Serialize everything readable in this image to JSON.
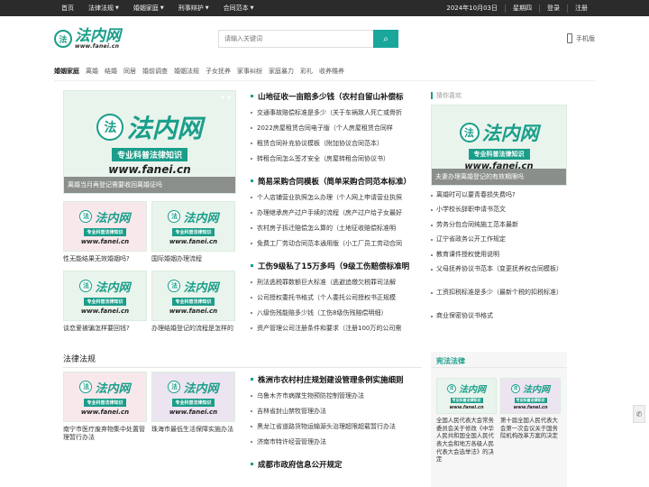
{
  "topnav": {
    "left": [
      "首页",
      "法律法规",
      "婚姻家庭",
      "刑事辩护",
      "合同范本"
    ],
    "right": [
      "2024年10月03日",
      "星期四",
      "登录",
      "注册"
    ]
  },
  "logo": {
    "cn": "法内网",
    "url": "www.fanei.cn",
    "badge": "法"
  },
  "search": {
    "placeholder": "请输入关键词",
    "button_icon": "search-icon"
  },
  "mobile": {
    "label": "手机版"
  },
  "catnav": [
    "婚姻家庭",
    "离婚",
    "结婚",
    "同居",
    "婚前调查",
    "婚姻法规",
    "子女抚养",
    "家事纠纷",
    "家庭暴力",
    "彩礼",
    "收养赡养"
  ],
  "thumb_text": {
    "cn": "法内网",
    "band": "专业科普法律知识",
    "url": "www.fanei.cn",
    "badge": "法"
  },
  "featured": {
    "caption": "离婚当月再登记需要收回离婚证吗"
  },
  "small_cards": [
    {
      "caption": "性无能结果无效婚姻吗?"
    },
    {
      "caption": "国际婚姻办理流程"
    },
    {
      "caption": "谈恋爱被骗怎样要回钱?"
    },
    {
      "caption": "办理结婚登记的流程是怎样的"
    }
  ],
  "news_blocks": [
    {
      "headline": "山地征收一亩赔多少钱（农村自留山补偿标",
      "items": [
        "交通事故赔偿标准是多少（关于车祸致人死亡或骨折",
        "2022房屋租赁合同电子版（个人房屋租赁合同样",
        "租赁合同补充协议模板（附加协议合同范本）",
        "转租合同怎么签才安全（房屋转租合同协议书）"
      ]
    },
    {
      "headline": "简易采购合同模板（简单采购合同范本标准）",
      "items": [
        "个人店铺营业执照怎么办理（个人网上申请营业执照",
        "办理继承房产过户手续的流程（房产过户给子女最好",
        "农村房子拆迁赔偿怎么算的（土地征收赔偿标准明",
        "免费工厂劳动合同范本通用版（小工厂员工劳动合同"
      ]
    },
    {
      "headline": "工伤9级私了15万多吗（9级工伤赔偿标准明",
      "items": [
        "刑法逃税罪数额巨大标准（逃避追缴欠税罪司法解",
        "公司授权委托书格式（个人委托公司授权书正规模",
        "八级伤残能赔多少钱（工伤8级伤残赔偿明细）",
        "资产管理公司注册条件和要求（注册100万的公司需"
      ]
    }
  ],
  "sidebar": {
    "title": "猜你喜欢",
    "thumb_caption": "夫妻办理离婚登记的有效期限吗",
    "items": [
      "离婚时可以要青春损失费吗?",
      "小学校长辞职申请书范文",
      "劳务分包合同纯施工范本最新",
      "辽宁省政务公开工作规定",
      "教育课件授权使用说明",
      "父母抚养协议书范本（变更抚养权合同模板）",
      "工资扣税标准是多少（最新个税的扣税标准）",
      "商业保密协议书格式"
    ]
  },
  "law_section": {
    "title": "法律法规",
    "cards": [
      {
        "caption": "南宁市医疗废弃物集中处置管理暂行办法"
      },
      {
        "caption": "珠海市最低生活保障实施办法"
      }
    ],
    "headline": "株洲市农村村庄规划建设管理条例实施细则",
    "items": [
      "乌鲁木齐市病媒生物预防控制管理办法",
      "吉林省封山禁牧管理办法",
      "黑龙江省道路货物运输源头治理超限超载暂行办法",
      "济南市特许经营管理办法"
    ],
    "headline2": "成都市政府信息公开规定"
  },
  "constitution_box": {
    "title": "宪法法律",
    "cards": [
      {
        "caption": "全国人民代表大会常务委员会关于修改《中华人民共和国全国人民代表大会和地方各级人民代表大会选举法》的决定"
      },
      {
        "caption": "第十届全国人民代表大会第一次会议关于国务院机构改革方案的决定"
      }
    ]
  },
  "float": {
    "icon": "phone-icon"
  }
}
